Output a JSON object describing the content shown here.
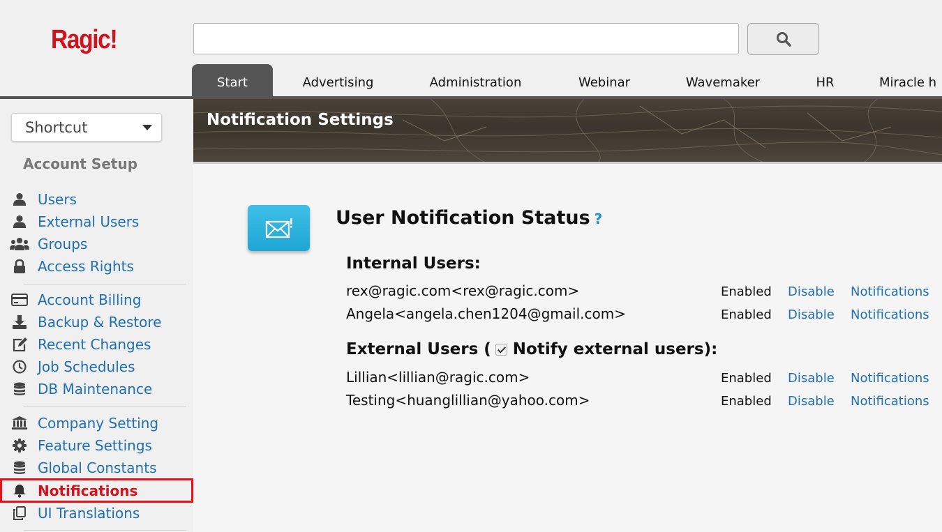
{
  "header": {
    "logo": "Ragic!",
    "search": {
      "value": "",
      "placeholder": ""
    },
    "search_icon": "search-icon",
    "tabs": [
      {
        "label": "Start",
        "active": true
      },
      {
        "label": "Advertising"
      },
      {
        "label": "Administration"
      },
      {
        "label": "Webinar"
      },
      {
        "label": "Wavemaker"
      },
      {
        "label": "HR"
      },
      {
        "label": "Miracle h"
      }
    ]
  },
  "sidebar": {
    "shortcut": "Shortcut",
    "section_title": "Account Setup",
    "items": [
      {
        "label": "Users",
        "icon": "user-icon"
      },
      {
        "label": "External Users",
        "icon": "user-icon"
      },
      {
        "label": "Groups",
        "icon": "group-icon"
      },
      {
        "label": "Access Rights",
        "icon": "lock-icon"
      },
      {
        "label": "Account Billing",
        "icon": "credit-card-icon"
      },
      {
        "label": "Backup & Restore",
        "icon": "download-icon"
      },
      {
        "label": "Recent Changes",
        "icon": "edit-icon"
      },
      {
        "label": "Job Schedules",
        "icon": "clock-icon"
      },
      {
        "label": "DB Maintenance",
        "icon": "database-icon"
      },
      {
        "label": "Company Setting",
        "icon": "bank-icon"
      },
      {
        "label": "Feature Settings",
        "icon": "gear-icon"
      },
      {
        "label": "Global Constants",
        "icon": "database-icon"
      },
      {
        "label": "Notifications",
        "icon": "bell-icon",
        "active": true
      },
      {
        "label": "UI Translations",
        "icon": "copy-icon"
      }
    ]
  },
  "banner": {
    "title": "Notification Settings"
  },
  "main": {
    "icon": "mail-icon",
    "heading": "User Notification Status",
    "help": "?",
    "internal_title": "Internal Users:",
    "external_title_pre": "External Users (",
    "external_title_post": "Notify external users):",
    "notify_external_checked": true,
    "internal_users": [
      {
        "email": "rex@ragic.com<rex@ragic.com>",
        "status": "Enabled",
        "action": "Disable",
        "link": "Notifications"
      },
      {
        "email": "Angela<angela.chen1204@gmail.com>",
        "status": "Enabled",
        "action": "Disable",
        "link": "Notifications"
      }
    ],
    "external_users": [
      {
        "email": "Lillian<lillian@ragic.com>",
        "status": "Enabled",
        "action": "Disable",
        "link": "Notifications"
      },
      {
        "email": "Testing<huanglillian@yahoo.com>",
        "status": "Enabled",
        "action": "Disable",
        "link": "Notifications"
      }
    ]
  },
  "colors": {
    "brand": "#d0141e",
    "link": "#1e6fb3",
    "active_tab": "#555555",
    "mail_badge": "#1ea6d4"
  }
}
